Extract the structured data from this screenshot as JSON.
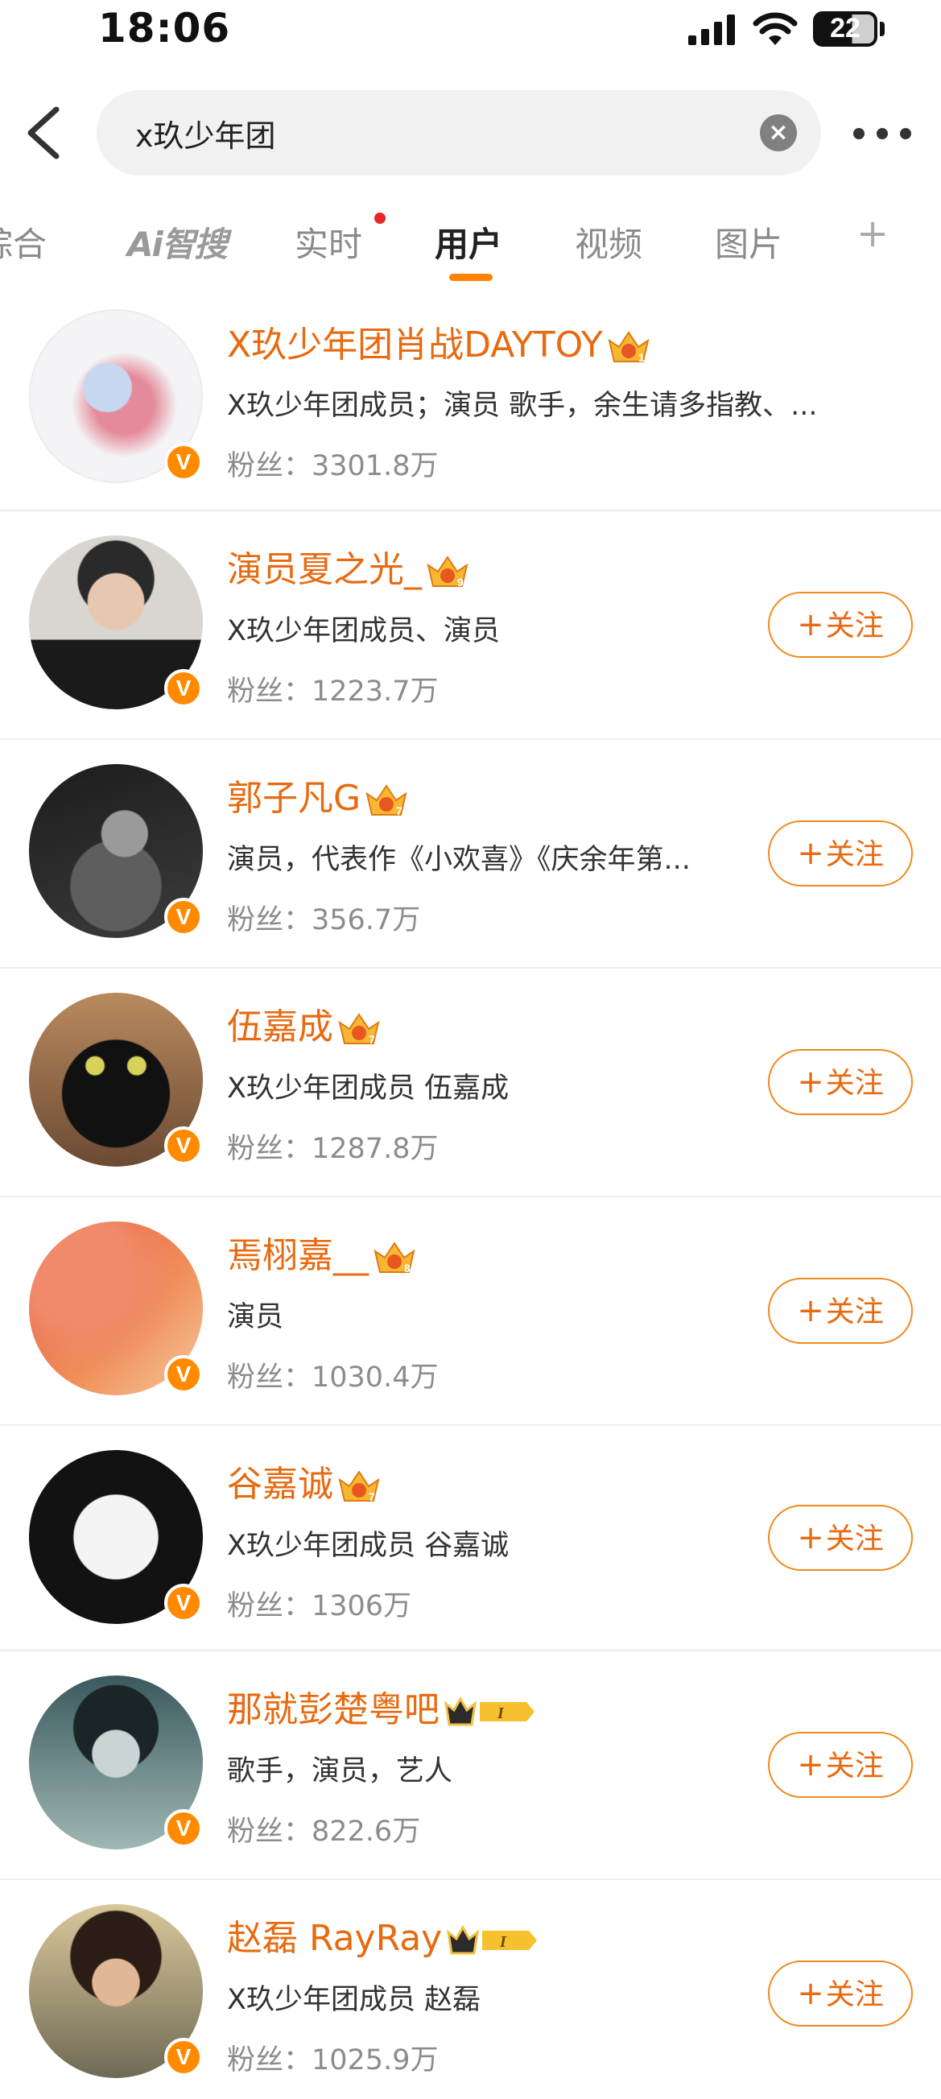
{
  "status_bar": {
    "time": "18:06",
    "battery": "22"
  },
  "search": {
    "query": "x玖少年团"
  },
  "tabs": [
    {
      "label": "综合"
    },
    {
      "label": "Ai智搜"
    },
    {
      "label": "实时"
    },
    {
      "label": "用户"
    },
    {
      "label": "视频"
    },
    {
      "label": "图片"
    },
    {
      "label": "+"
    }
  ],
  "active_tab": "用户",
  "follow_label": "关注",
  "users": [
    {
      "name": "X玖少年团肖战DAYTOY",
      "desc": "X玖少年团成员；演员 歌手，余生请多指教、...",
      "fans": "粉丝：3301.8万",
      "crown": "10",
      "follow": false
    },
    {
      "name": "演员夏之光_",
      "desc": "X玖少年团成员、演员",
      "fans": "粉丝：1223.7万",
      "crown": "9",
      "follow": true
    },
    {
      "name": "郭子凡G",
      "desc": "演员，代表作《小欢喜》《庆余年第...",
      "fans": "粉丝：356.7万",
      "crown": "7",
      "follow": true
    },
    {
      "name": "伍嘉成",
      "desc": "X玖少年团成员  伍嘉成",
      "fans": "粉丝：1287.8万",
      "crown": "7",
      "follow": true
    },
    {
      "name": "焉栩嘉__",
      "desc": "演员",
      "fans": "粉丝：1030.4万",
      "crown": "8",
      "follow": true
    },
    {
      "name": "谷嘉诚",
      "desc": "X玖少年团成员  谷嘉诚",
      "fans": "粉丝：1306万",
      "crown": "7",
      "follow": true
    },
    {
      "name": "那就彭楚粤吧",
      "desc": "歌手，演员，艺人",
      "fans": "粉丝：822.6万",
      "crown": "I",
      "follow": true
    },
    {
      "name": "赵磊 RayRay",
      "desc": "X玖少年团成员 赵磊",
      "fans": "粉丝：1025.9万",
      "crown": "I",
      "follow": true
    }
  ],
  "colors": {
    "accent": "#ff8200",
    "name": "#e86a10",
    "badge": "#ff8a00"
  }
}
